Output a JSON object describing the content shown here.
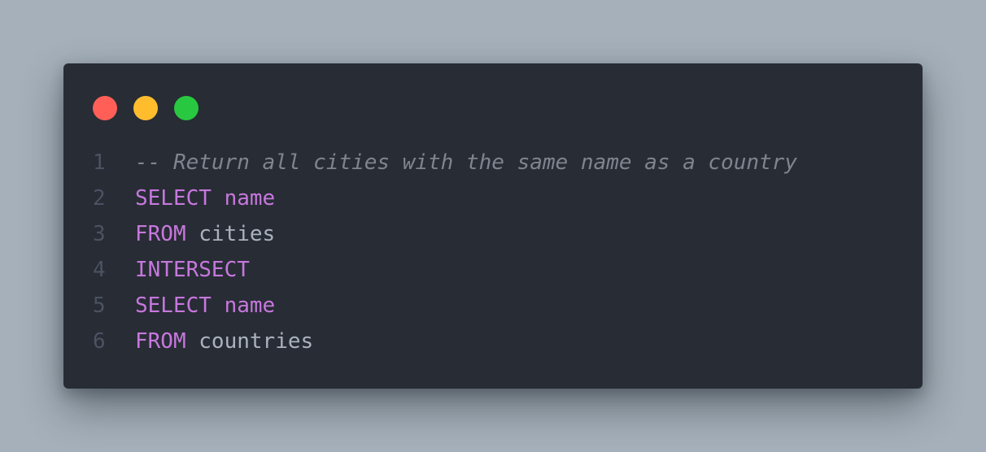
{
  "window": {
    "controls": [
      {
        "name": "close",
        "color": "#ff5f57"
      },
      {
        "name": "minimize",
        "color": "#ffbd2e"
      },
      {
        "name": "maximize",
        "color": "#28c840"
      }
    ]
  },
  "code": {
    "language": "sql",
    "lines": [
      {
        "number": "1",
        "tokens": [
          {
            "type": "comment",
            "text": "-- Return all cities with the same name as a country"
          }
        ]
      },
      {
        "number": "2",
        "tokens": [
          {
            "type": "keyword",
            "text": "SELECT"
          },
          {
            "type": "space",
            "text": " "
          },
          {
            "type": "column",
            "text": "name"
          }
        ]
      },
      {
        "number": "3",
        "tokens": [
          {
            "type": "keyword",
            "text": "FROM"
          },
          {
            "type": "space",
            "text": " "
          },
          {
            "type": "plain",
            "text": "cities"
          }
        ]
      },
      {
        "number": "4",
        "tokens": [
          {
            "type": "keyword",
            "text": "INTERSECT"
          }
        ]
      },
      {
        "number": "5",
        "tokens": [
          {
            "type": "keyword",
            "text": "SELECT"
          },
          {
            "type": "space",
            "text": " "
          },
          {
            "type": "column",
            "text": "name"
          }
        ]
      },
      {
        "number": "6",
        "tokens": [
          {
            "type": "keyword",
            "text": "FROM"
          },
          {
            "type": "space",
            "text": " "
          },
          {
            "type": "plain",
            "text": "countries"
          }
        ]
      }
    ]
  },
  "colors": {
    "background": "#a5b0ba",
    "window": "#282c35",
    "line_number": "#4b5261",
    "comment": "#7f848e",
    "keyword": "#c678dd",
    "plain": "#abb2bf"
  }
}
